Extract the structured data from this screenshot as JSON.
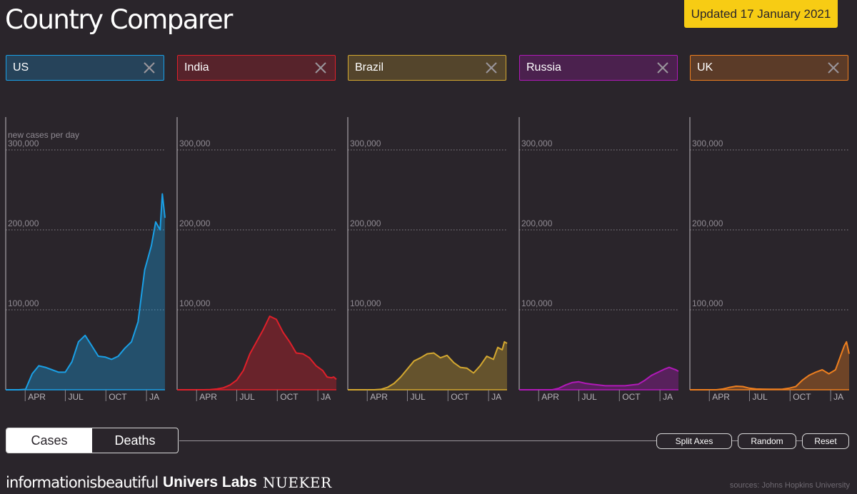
{
  "app": {
    "title": "Country Comparer",
    "updated": "Updated 17 January 2021"
  },
  "countries": [
    {
      "name": "US",
      "color": "#1aa0e6"
    },
    {
      "name": "India",
      "color": "#e0202a"
    },
    {
      "name": "Brazil",
      "color": "#d4a830"
    },
    {
      "name": "Russia",
      "color": "#b019b8"
    },
    {
      "name": "UK",
      "color": "#ee7f1f"
    }
  ],
  "controls": {
    "cases_label": "Cases",
    "deaths_label": "Deaths",
    "active": "Cases",
    "split_axes_label": "Split Axes",
    "random_label": "Random",
    "reset_label": "Reset"
  },
  "footer": {
    "brand1": "informationisbeautiful",
    "brand2": "Univers Labs",
    "brand3": "NUEKER",
    "sources": "sources: Johns Hopkins University"
  },
  "chart_data": {
    "type": "area",
    "ylabel": "new cases per day",
    "ylim": [
      0,
      300000
    ],
    "yticks": [
      100000,
      200000,
      300000
    ],
    "ytick_labels": [
      "100,000",
      "200,000",
      "300,000"
    ],
    "xlim": [
      0,
      361
    ],
    "xticks": [
      70,
      161,
      253,
      345
    ],
    "xtick_labels": [
      "APR",
      "JUL",
      "OCT",
      "JA"
    ],
    "grid": true,
    "x": [
      0,
      15,
      30,
      45,
      60,
      75,
      90,
      105,
      120,
      135,
      150,
      165,
      180,
      195,
      210,
      225,
      240,
      255,
      270,
      285,
      300,
      315,
      330,
      340,
      350,
      355,
      361
    ],
    "series": [
      {
        "name": "US",
        "values": [
          0,
          0,
          0,
          500,
          20000,
          30000,
          28000,
          25000,
          22000,
          22000,
          35000,
          60000,
          68000,
          55000,
          42000,
          41000,
          38000,
          42000,
          52000,
          60000,
          85000,
          150000,
          180000,
          210000,
          200000,
          245000,
          215000
        ]
      },
      {
        "name": "India",
        "values": [
          0,
          0,
          0,
          0,
          0,
          200,
          1000,
          2500,
          6000,
          12000,
          24000,
          45000,
          60000,
          75000,
          92000,
          88000,
          72000,
          60000,
          46000,
          45000,
          40000,
          30000,
          24000,
          16000,
          15000,
          16000,
          13000
        ]
      },
      {
        "name": "Brazil",
        "values": [
          0,
          0,
          0,
          0,
          0,
          500,
          3000,
          8000,
          16000,
          26000,
          36000,
          40000,
          45000,
          46000,
          40000,
          43000,
          34000,
          28000,
          27000,
          21000,
          30000,
          42000,
          38000,
          53000,
          50000,
          60000,
          58000
        ]
      },
      {
        "name": "Russia",
        "values": [
          0,
          0,
          0,
          0,
          0,
          0,
          2000,
          6000,
          9000,
          10000,
          8000,
          7000,
          6000,
          5000,
          5000,
          5000,
          5000,
          6000,
          7000,
          12000,
          18000,
          22000,
          26000,
          28000,
          26000,
          25000,
          23000
        ]
      },
      {
        "name": "UK",
        "values": [
          0,
          0,
          0,
          0,
          0,
          1000,
          3000,
          4500,
          4000,
          2000,
          1000,
          800,
          600,
          700,
          800,
          2000,
          4000,
          12000,
          18000,
          22000,
          25000,
          20000,
          25000,
          40000,
          55000,
          60000,
          45000
        ]
      }
    ]
  }
}
